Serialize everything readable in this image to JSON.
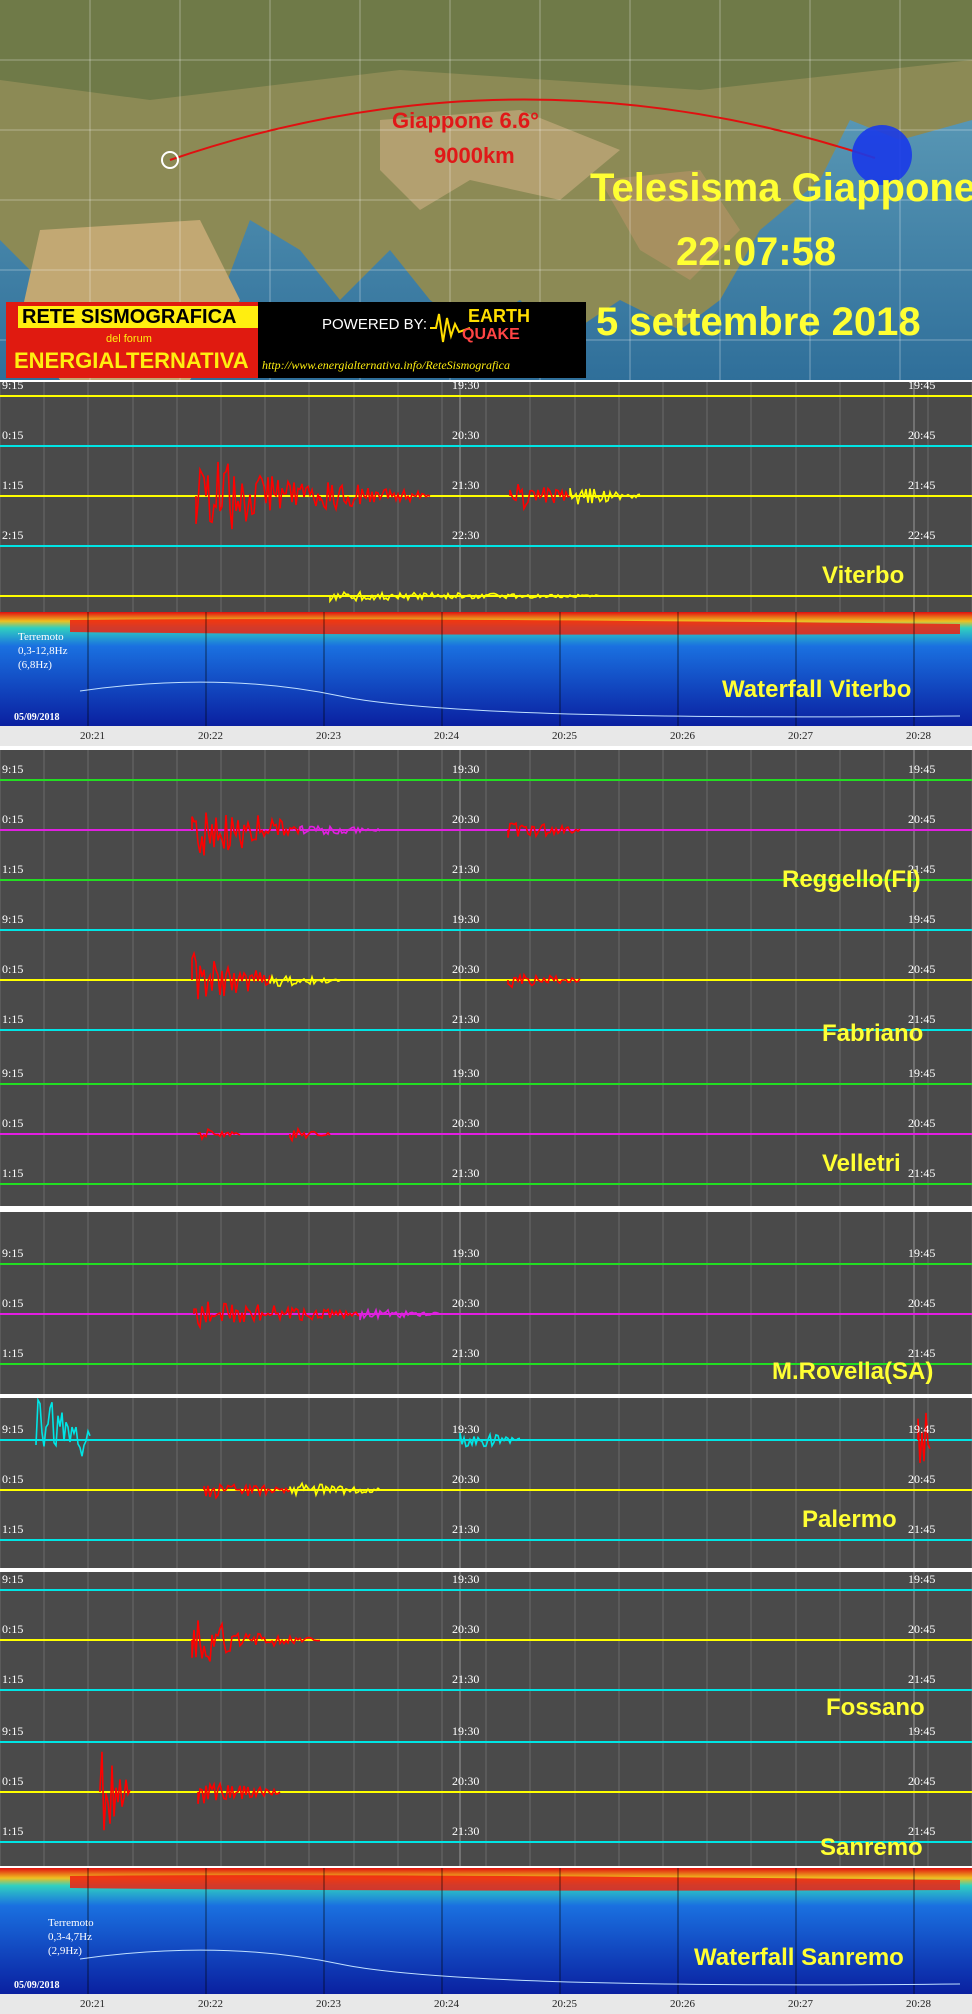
{
  "header": {
    "event_label": "Giappone 6.6°",
    "distance_label": "9000km",
    "title_line1": "Telesisma Giappone",
    "title_line2": "22:07:58",
    "title_line3": "5 settembre 2018"
  },
  "banner": {
    "network_title": "RETE SISMOGRAFICA",
    "forum_label": "del forum",
    "brand": "ENERGIALTERNATIVA",
    "powered_by": "POWERED BY:",
    "partner_top": "EARTH",
    "partner_bottom": "QUAKE",
    "url": "http://www.energialternativa.info/ReteSismografica"
  },
  "colors": {
    "red": "#ff0000",
    "yellow": "#ffff00",
    "cyan": "#00e5e5",
    "green": "#22dd22",
    "magenta": "#e020e0"
  },
  "stations": [
    {
      "name": "Viterbo",
      "labels_left": [
        "9:15",
        "0:15",
        "1:15",
        "2:15"
      ],
      "labels_right": [
        "19:30",
        "19:45",
        "20:30",
        "20:45",
        "21:30",
        "21:45",
        "22:30",
        "22:45"
      ]
    },
    {
      "name": "Reggello(FI)",
      "labels_left": [
        "9:15",
        "0:15",
        "1:15"
      ],
      "labels_right": [
        "19:30",
        "19:45",
        "20:30",
        "20:45",
        "21:30",
        "21:45"
      ]
    },
    {
      "name": "Fabriano",
      "labels_left": [
        "9:15",
        "0:15",
        "1:15"
      ],
      "labels_right": [
        "19:30",
        "19:45",
        "20:30",
        "20:45",
        "21:30",
        "21:45"
      ]
    },
    {
      "name": "Velletri",
      "labels_left": [
        "9:15",
        "0:15",
        "1:15"
      ],
      "labels_right": [
        "19:30",
        "19:45",
        "20:30",
        "20:45",
        "21:30",
        "21:45"
      ]
    },
    {
      "name": "M.Rovella(SA)",
      "labels_left": [
        "9:15",
        "0:15",
        "1:15"
      ],
      "labels_right": [
        "19:30",
        "19:45",
        "20:30",
        "20:45",
        "21:30",
        "21:45"
      ]
    },
    {
      "name": "Palermo",
      "labels_left": [
        "9:15",
        "0:15",
        "1:15"
      ],
      "labels_right": [
        "19:30",
        "19:45",
        "20:30",
        "20:45",
        "21:30",
        "21:45"
      ]
    },
    {
      "name": "Fossano",
      "labels_left": [
        "9:15",
        "0:15",
        "1:15"
      ],
      "labels_right": [
        "19:30",
        "19:45",
        "20:30",
        "20:45",
        "21:30",
        "21:45"
      ]
    },
    {
      "name": "Sanremo",
      "labels_left": [
        "9:15",
        "0:15",
        "1:15"
      ],
      "labels_right": [
        "19:30",
        "19:45",
        "20:30",
        "20:45",
        "21:30",
        "21:45"
      ]
    }
  ],
  "waterfall_viterbo": {
    "title": "Waterfall Viterbo",
    "note_line1": "Terremoto",
    "note_line2": "0,3-12,8Hz",
    "note_line3": "(6,8Hz)",
    "date": "05/09/2018",
    "ticks": [
      "20:21",
      "20:22",
      "20:23",
      "20:24",
      "20:25",
      "20:26",
      "20:27",
      "20:28"
    ]
  },
  "waterfall_sanremo": {
    "title": "Waterfall Sanremo",
    "note_line1": "Terremoto",
    "note_line2": "0,3-4,7Hz",
    "note_line3": "(2,9Hz)",
    "date": "05/09/2018",
    "ticks": [
      "20:21",
      "20:22",
      "20:23",
      "20:24",
      "20:25",
      "20:26",
      "20:27",
      "20:28"
    ]
  }
}
